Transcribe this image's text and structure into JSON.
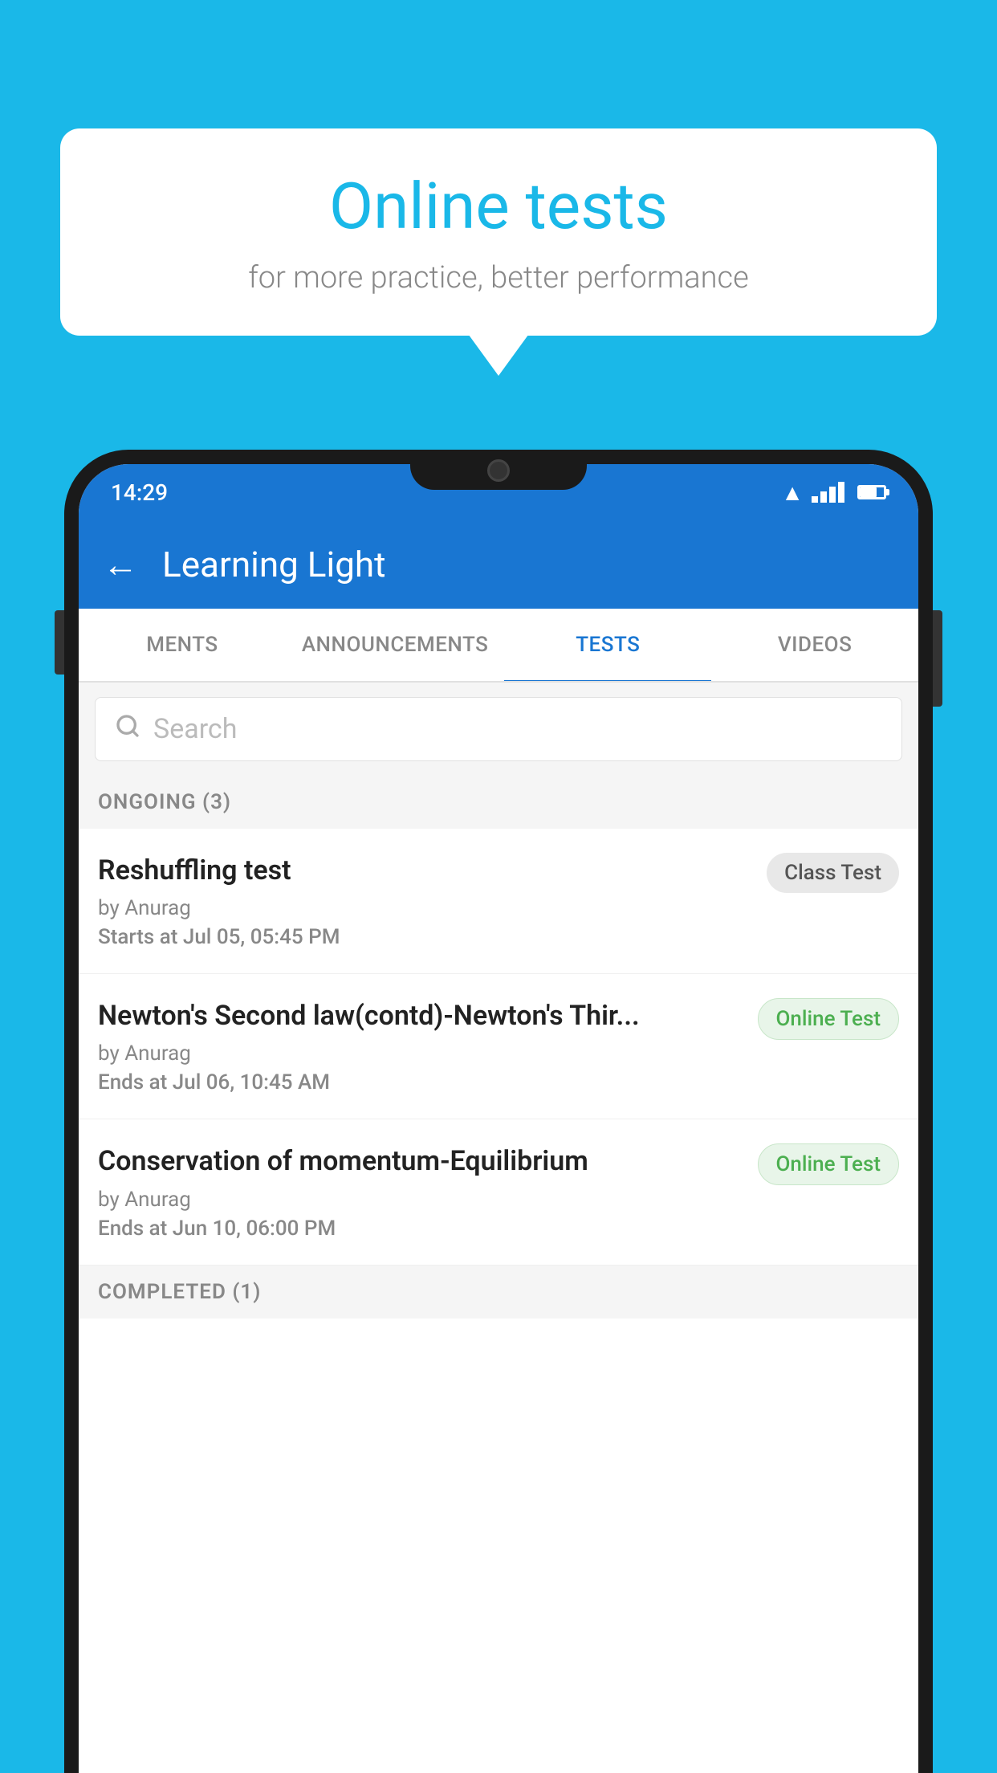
{
  "background_color": "#1ab8e8",
  "speech_bubble": {
    "title": "Online tests",
    "subtitle": "for more practice, better performance"
  },
  "phone": {
    "status_bar": {
      "time": "14:29"
    },
    "header": {
      "title": "Learning Light",
      "back_label": "←"
    },
    "tabs": [
      {
        "label": "MENTS",
        "active": false
      },
      {
        "label": "ANNOUNCEMENTS",
        "active": false
      },
      {
        "label": "TESTS",
        "active": true
      },
      {
        "label": "VIDEOS",
        "active": false
      }
    ],
    "search": {
      "placeholder": "Search"
    },
    "ongoing_section": {
      "label": "ONGOING (3)"
    },
    "tests": [
      {
        "name": "Reshuffling test",
        "author": "by Anurag",
        "time_label": "Starts at",
        "time_value": "Jul 05, 05:45 PM",
        "badge": "Class Test",
        "badge_type": "class"
      },
      {
        "name": "Newton's Second law(contd)-Newton's Thir...",
        "author": "by Anurag",
        "time_label": "Ends at",
        "time_value": "Jul 06, 10:45 AM",
        "badge": "Online Test",
        "badge_type": "online"
      },
      {
        "name": "Conservation of momentum-Equilibrium",
        "author": "by Anurag",
        "time_label": "Ends at",
        "time_value": "Jun 10, 06:00 PM",
        "badge": "Online Test",
        "badge_type": "online"
      }
    ],
    "completed_section": {
      "label": "COMPLETED (1)"
    }
  }
}
